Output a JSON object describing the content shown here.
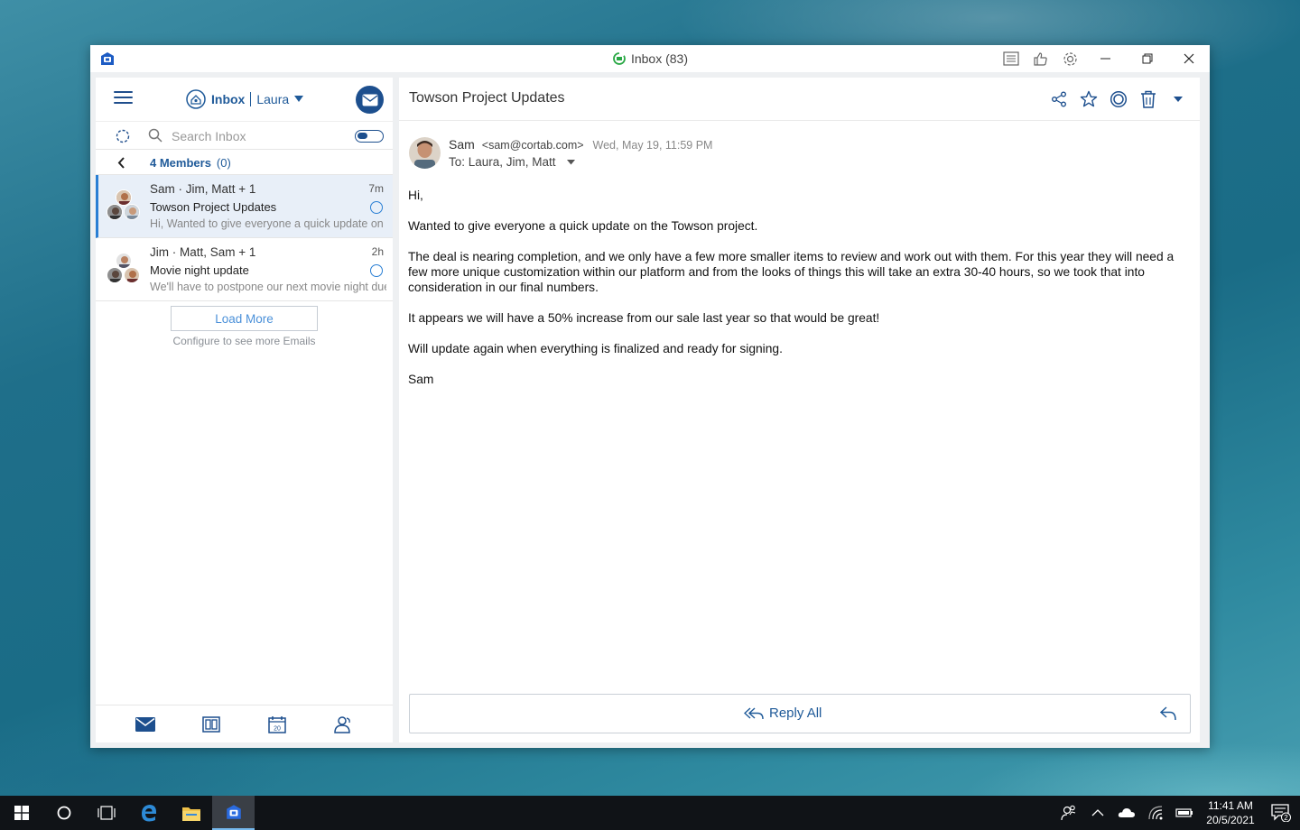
{
  "window": {
    "title": "Inbox (83)"
  },
  "inbox": {
    "label": "Inbox",
    "account": "Laura",
    "search_placeholder": "Search Inbox",
    "members_label": "4 Members",
    "members_count": "(0)"
  },
  "threads": [
    {
      "from": "Sam · Jim, Matt + 1",
      "time": "7m",
      "subject": "Towson Project Updates",
      "preview": "Hi, Wanted to give everyone a quick update on the Towson project.",
      "selected": true
    },
    {
      "from": "Jim · Matt, Sam + 1",
      "time": "2h",
      "subject": "Movie night update",
      "preview": "We'll have to postpone our next movie night due to scheduling.",
      "selected": false
    }
  ],
  "load_more": {
    "label": "Load More",
    "note": "Configure to see more Emails"
  },
  "message": {
    "subject": "Towson Project Updates",
    "sender_name": "Sam",
    "sender_email": "<sam@cortab.com>",
    "date": "Wed, May 19, 11:59 PM",
    "to": "To: Laura, Jim, Matt",
    "body": [
      "Hi,",
      "Wanted to give everyone a quick update on the Towson project.",
      "The deal is nearing completion, and we only have a few more smaller items to review and work out with them. For this year they will need a few more unique customization within our platform and from the looks of things this will take an extra 30-40 hours, so we took that into consideration in our final numbers.",
      "It appears we will have a 50% increase from our sale last year so that would be great!",
      "Will update again when everything is finalized and ready for signing.",
      "Sam"
    ],
    "reply_all_label": "Reply All"
  },
  "taskbar": {
    "time": "11:41 AM",
    "date": "20/5/2021",
    "notification_count": "2"
  },
  "colors": {
    "accent": "#1d4f8e",
    "link_blue": "#4a90d9",
    "unread_ring": "#2a7fd4",
    "selected_bg": "#e8eff8"
  }
}
